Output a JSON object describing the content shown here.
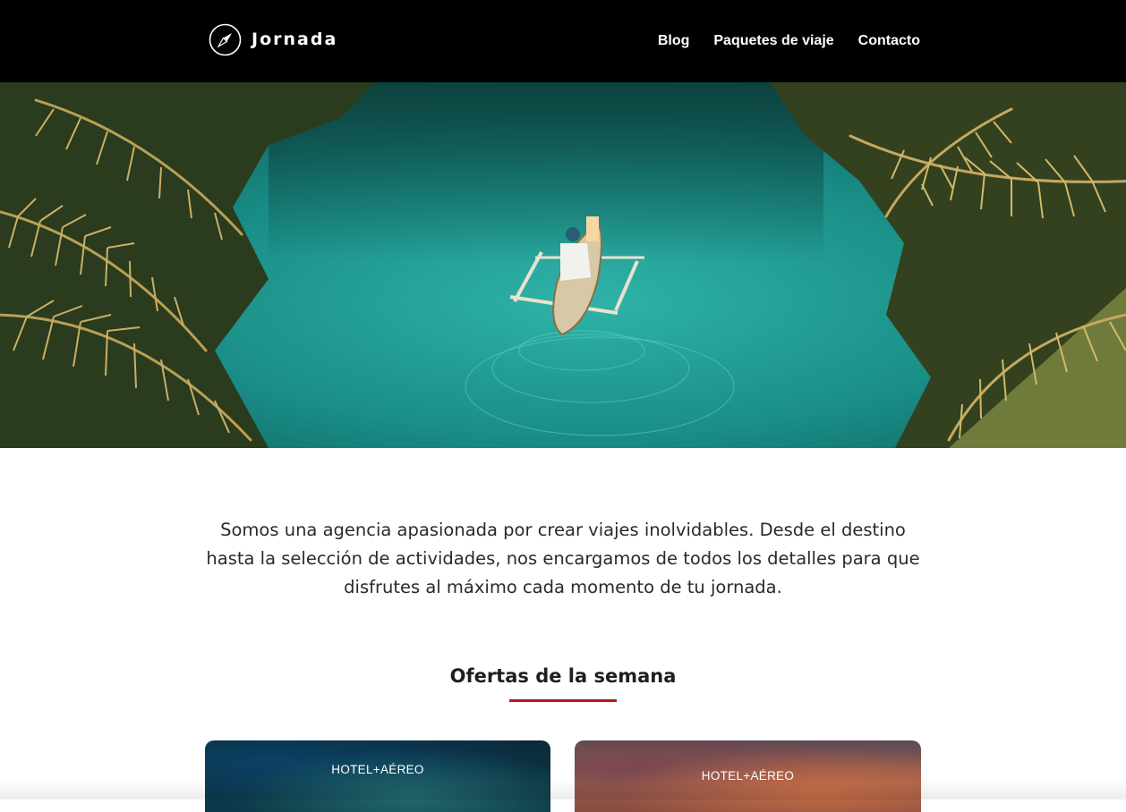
{
  "header": {
    "brand": "Jornada",
    "logo_icon": "compass-icon",
    "background": "#000000",
    "nav": [
      {
        "label": "Blog"
      },
      {
        "label": "Paquetes de viaje"
      },
      {
        "label": "Contacto"
      }
    ]
  },
  "hero": {
    "image": "aerial-river-canoe-palms",
    "water_color": "#1b8a86"
  },
  "intro": {
    "text": "Somos una agencia apasionada por crear viajes inolvidables. Desde el destino hasta la selección de actividades, nos encargamos de todos los detalles para que disfrutes al máximo cada momento de tu jornada."
  },
  "offers": {
    "title": "Ofertas de la semana",
    "accent": "#b3191c",
    "cards": [
      {
        "badge": "HOTEL+AÉREO"
      },
      {
        "badge": "HOTEL+AÉREO"
      }
    ]
  }
}
